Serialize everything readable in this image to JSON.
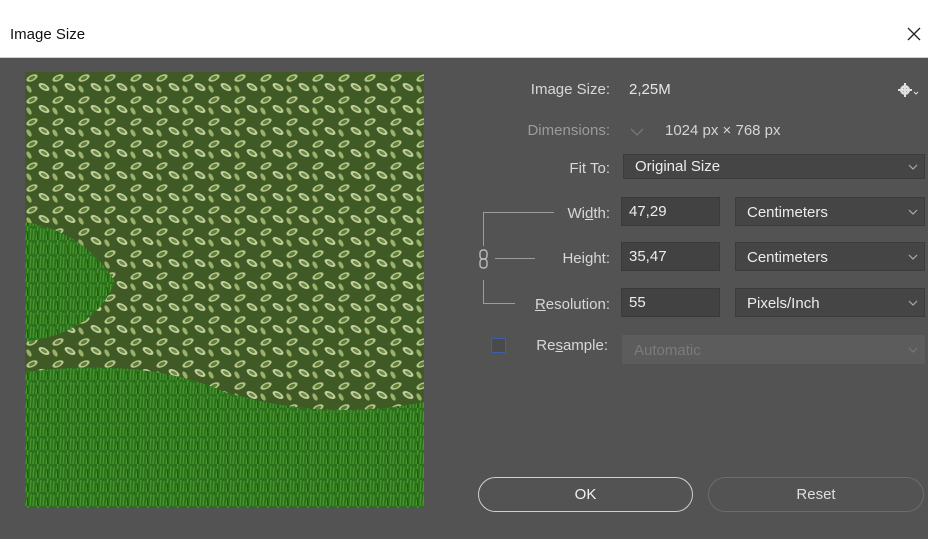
{
  "window": {
    "title": "Image Size"
  },
  "info": {
    "image_size_label": "Image Size:",
    "image_size_value": "2,25M",
    "dimensions_label": "Dimensions:",
    "dimensions_value": "1024 px  ×  768 px"
  },
  "fit_to": {
    "label": "Fit To:",
    "value": "Original Size"
  },
  "width": {
    "label_pre": "Wi",
    "label_u": "d",
    "label_post": "th:",
    "value": "47,29",
    "unit": "Centimeters"
  },
  "height": {
    "label_pre": "Hei",
    "label_u": "g",
    "label_post": "ht:",
    "value": "35,47",
    "unit": "Centimeters"
  },
  "resolution": {
    "label_pre": "",
    "label_u": "R",
    "label_post": "esolution:",
    "value": "55",
    "unit": "Pixels/Inch"
  },
  "resample": {
    "label_pre": "Re",
    "label_u": "s",
    "label_post": "ample:",
    "value": "Automatic",
    "checked": false
  },
  "buttons": {
    "ok": "OK",
    "reset": "Reset"
  },
  "icons": {
    "close": "close-icon",
    "gear": "gear-icon",
    "link": "chain-link-icon",
    "dimension_dropdown": "chevron-down-icon"
  },
  "colors": {
    "dialog_bg": "#535353",
    "field_bg": "#424242",
    "text": "#d7d7d7",
    "checkbox_border": "#3d5ea8"
  }
}
